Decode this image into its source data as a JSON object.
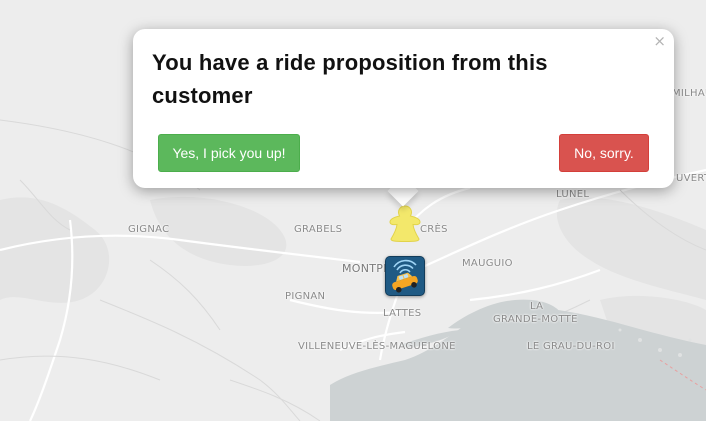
{
  "map": {
    "places": [
      {
        "id": "gignac",
        "label": "GIGNAC"
      },
      {
        "id": "grabels",
        "label": "GRABELS"
      },
      {
        "id": "cres",
        "label": "CRÈS"
      },
      {
        "id": "montpellier",
        "label": "MONTPELLIER"
      },
      {
        "id": "mauguio",
        "label": "MAUGUIO"
      },
      {
        "id": "pignan",
        "label": "PIGNAN"
      },
      {
        "id": "lattes",
        "label": "LATTES"
      },
      {
        "id": "villeneuve",
        "label": "VILLENEUVE-LÈS-MAGUELONE"
      },
      {
        "id": "la",
        "label": "LA"
      },
      {
        "id": "grande-motte",
        "label": "GRANDE-MOTTE"
      },
      {
        "id": "grau-du-roi",
        "label": "LE GRAU-DU-ROI"
      },
      {
        "id": "lunel",
        "label": "LUNEL"
      },
      {
        "id": "milhau",
        "label": "MILHAU"
      },
      {
        "id": "uvert",
        "label": "UVERT"
      }
    ]
  },
  "popup": {
    "title": "You have a ride proposition from this customer",
    "close_symbol": "×",
    "accept_label": "Yes, I pick you up!",
    "decline_label": "No, sorry."
  },
  "markers": {
    "customer_icon": "meeple-icon",
    "driver_icon": "taxi-car-icon"
  },
  "colors": {
    "accept": "#5cb85c",
    "decline": "#d9534f",
    "water": "#cfd3d4",
    "land": "#ececec",
    "customer_marker": "#f5e96a",
    "driver_marker_bg": "#1f5a84"
  }
}
